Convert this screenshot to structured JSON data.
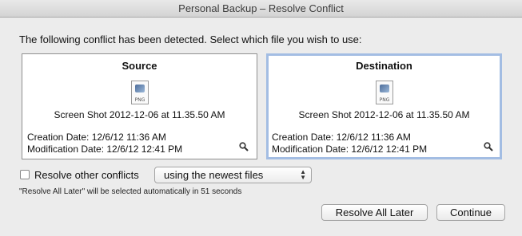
{
  "window": {
    "title": "Personal Backup – Resolve Conflict"
  },
  "prompt": "The following conflict has been detected. Select which file you wish to use:",
  "source": {
    "heading": "Source",
    "file_type": "PNG",
    "file_name": "Screen Shot 2012-12-06 at 11.35.50 AM",
    "creation": "Creation Date: 12/6/12 11:36 AM",
    "modification": "Modification Date: 12/6/12 12:41 PM",
    "icons": {
      "file": "png-file-icon",
      "preview": "magnifier-icon"
    }
  },
  "destination": {
    "heading": "Destination",
    "file_type": "PNG",
    "file_name": "Screen Shot 2012-12-06 at 11.35.50 AM",
    "creation": "Creation Date: 12/6/12 11:36 AM",
    "modification": "Modification Date: 12/6/12 12:41 PM",
    "selected": true,
    "icons": {
      "file": "png-file-icon",
      "preview": "magnifier-icon"
    }
  },
  "resolve_other": {
    "label": "Resolve other conflicts",
    "checked": false
  },
  "strategy": {
    "selected": "using the newest files"
  },
  "note": "\"Resolve All Later\" will be selected automatically in 51 seconds",
  "buttons": {
    "later": "Resolve All Later",
    "continue": "Continue"
  },
  "colors": {
    "selection_border": "#a3bde3",
    "background": "#ececec"
  }
}
